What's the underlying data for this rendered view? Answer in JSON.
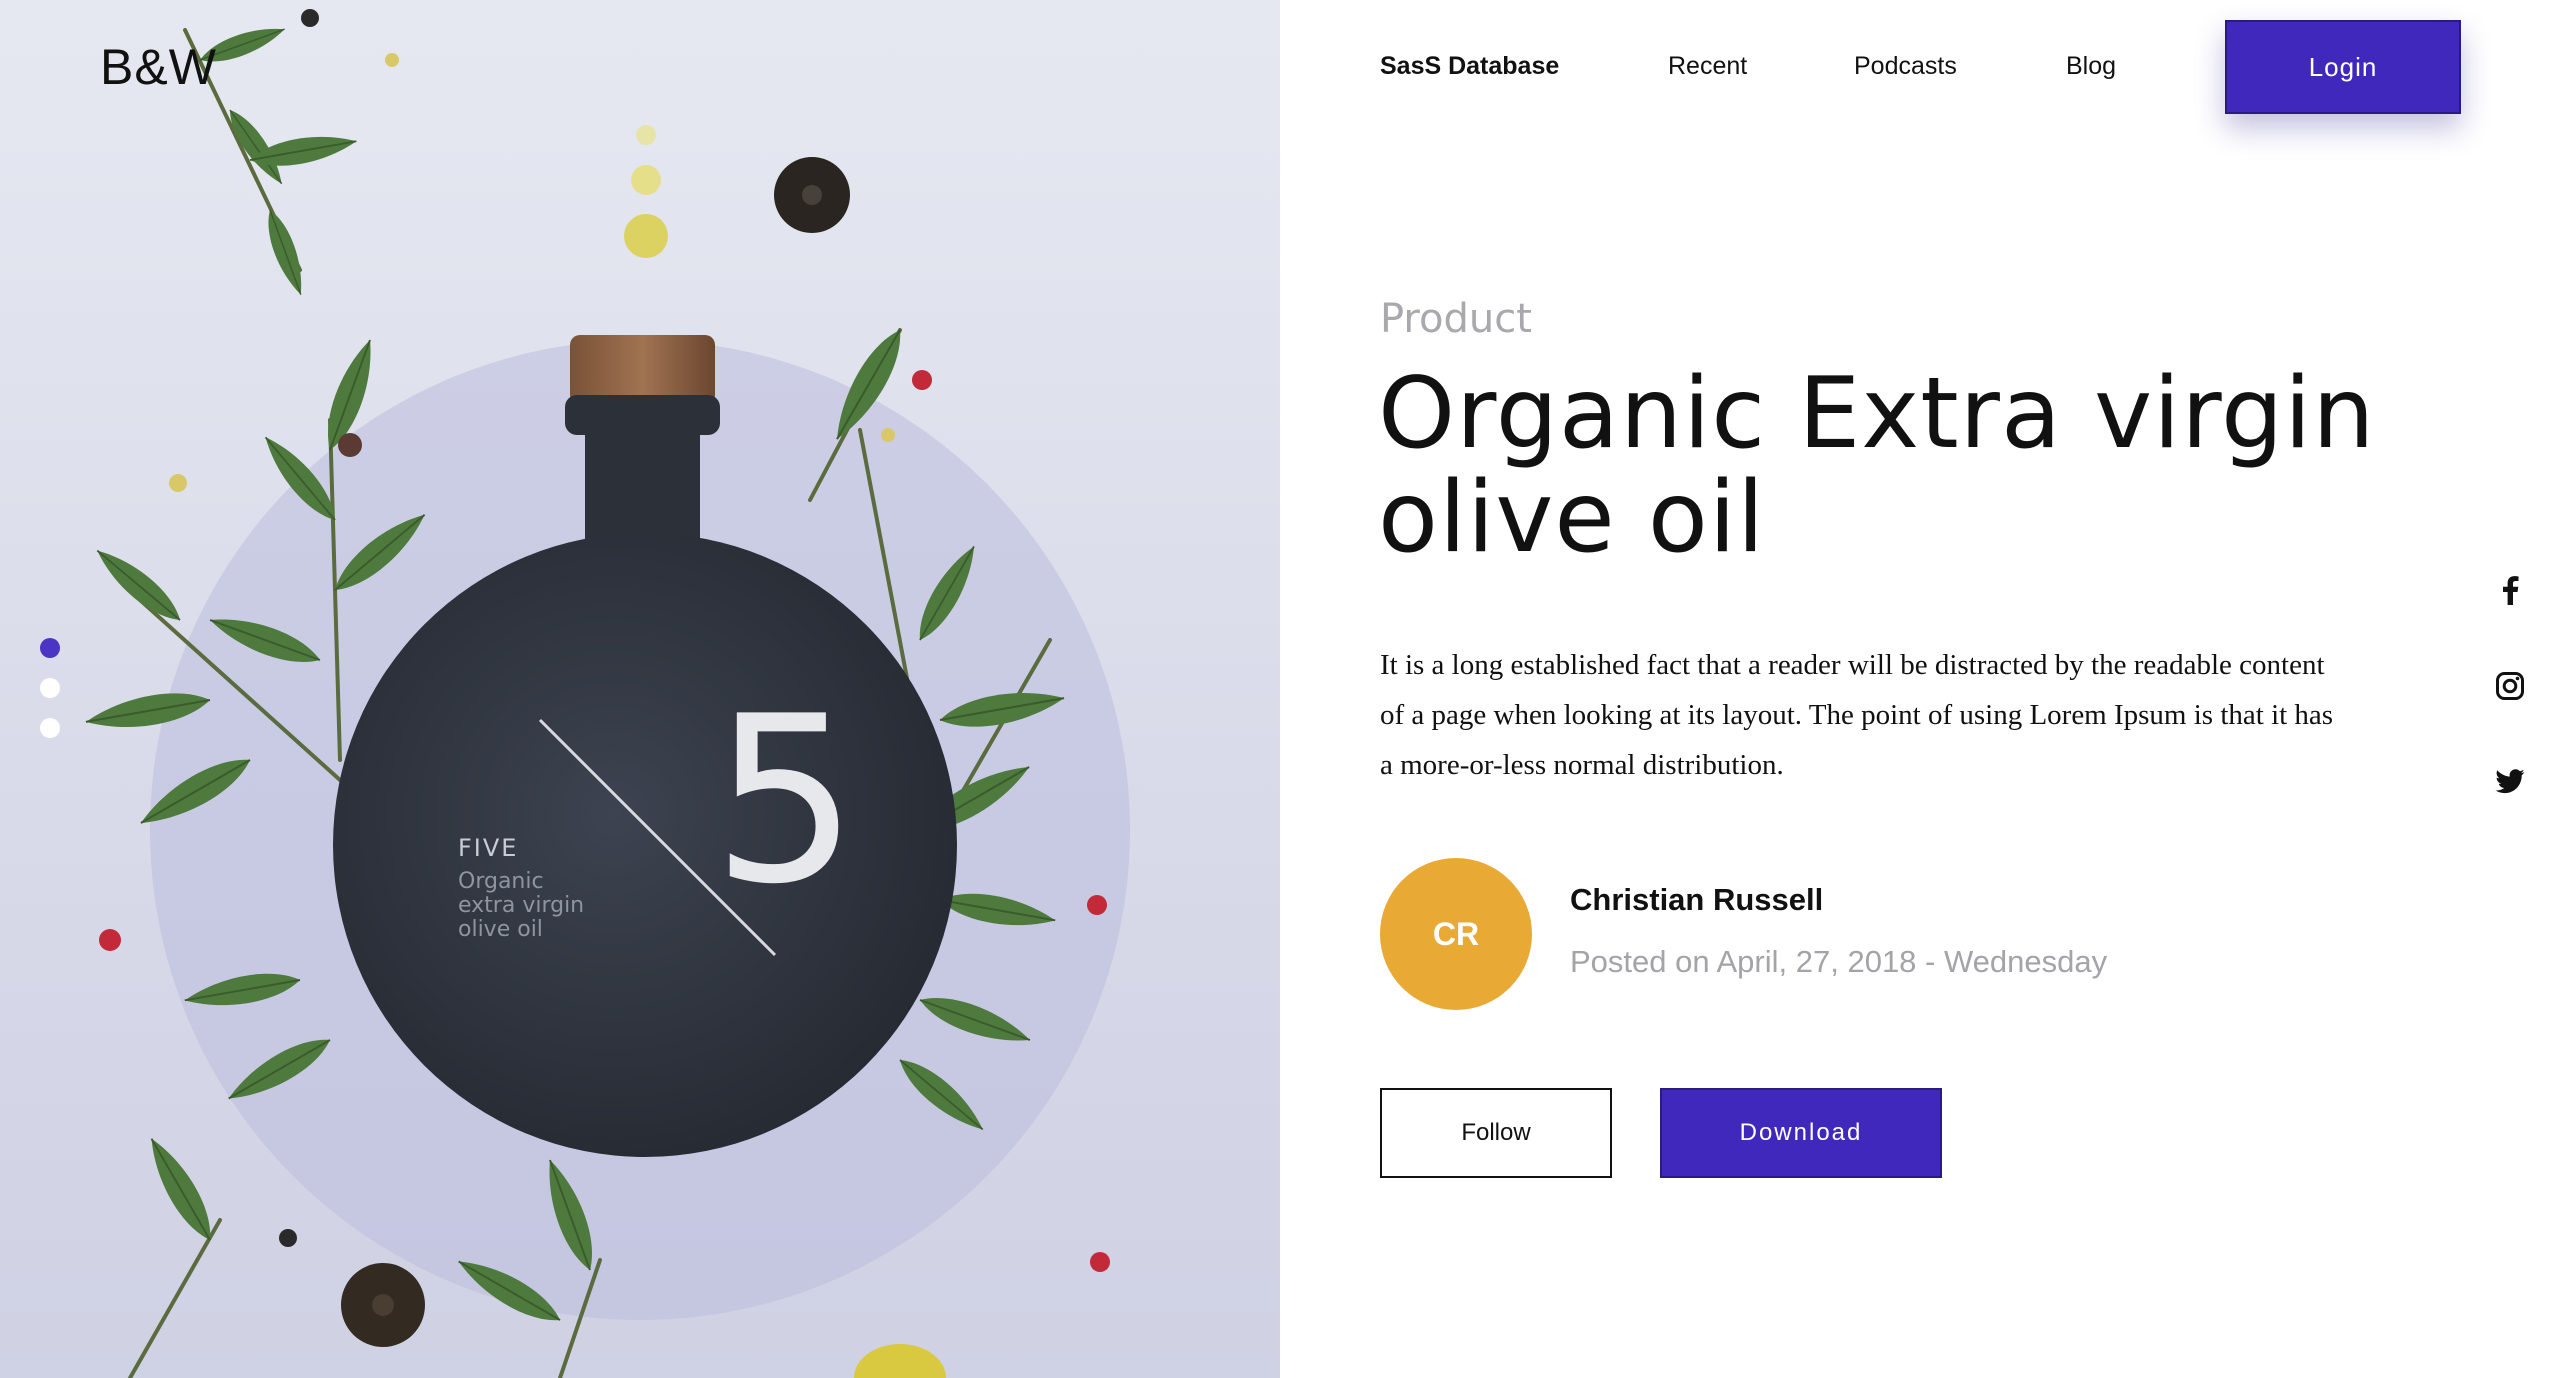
{
  "brand": {
    "logo": "B&W"
  },
  "nav": {
    "items": [
      {
        "label": "SasS Database",
        "active": true
      },
      {
        "label": "Recent"
      },
      {
        "label": "Podcasts"
      },
      {
        "label": "Blog"
      }
    ],
    "login_label": "Login"
  },
  "hero": {
    "bottle_label": {
      "brand": "FIVE",
      "line1": "Organic",
      "line2": "extra virgin",
      "line3": "olive oil",
      "numeral": "5"
    },
    "slides": {
      "count": 3,
      "active": 1
    }
  },
  "article": {
    "category": "Product",
    "title_line1": "Organic Extra virgin",
    "title_line2": "olive oil",
    "description": "It is a long established fact that a reader will be distracted by the readable content of a page when looking at its layout. The point of using Lorem Ipsum is that it has a more-or-less normal distribution."
  },
  "author": {
    "initials": "CR",
    "name": "Christian Russell",
    "posted": "Posted on April, 27, 2018 - Wednesday"
  },
  "actions": {
    "follow_label": "Follow",
    "download_label": "Download"
  },
  "social": [
    {
      "icon": "facebook-icon"
    },
    {
      "icon": "instagram-icon"
    },
    {
      "icon": "twitter-icon"
    }
  ],
  "colors": {
    "accent": "#4128bd",
    "avatar": "#e8a935",
    "muted_text": "#a8a8ad",
    "hero_bg": "#dcdeeb"
  }
}
